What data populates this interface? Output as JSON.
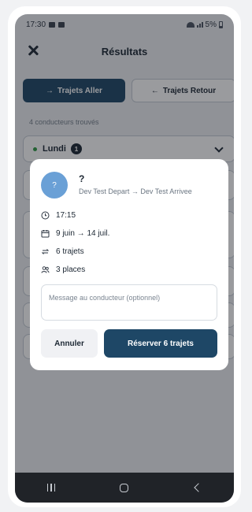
{
  "status_bar": {
    "time": "17:30",
    "battery": "5%"
  },
  "header": {
    "title": "Résultats"
  },
  "tabs": [
    {
      "label": "Trajets Aller",
      "arrow": "→",
      "active": true
    },
    {
      "label": "Trajets Retour",
      "arrow": "←",
      "active": false
    }
  ],
  "results": {
    "count_text": "4 conducteurs trouvés"
  },
  "day": {
    "label": "Lundi",
    "count": "1"
  },
  "modal": {
    "avatar_text": "?",
    "driver_name": "?",
    "route": "Dev Test Depart → Dev Test Arrivee",
    "time": "17:15",
    "dates": "9 juin → 14 juil.",
    "trips": "6 trajets",
    "seats": "3 places",
    "message_placeholder": "Message au conducteur (optionnel)",
    "cancel_label": "Annuler",
    "book_label": "Réserver 6 trajets"
  },
  "colors": {
    "primary": "#1e4766",
    "available_dot": "#2e9a44",
    "avatar": "#6aa0d6"
  },
  "icons": {
    "time": "clock-icon",
    "dates": "calendar-icon",
    "trips": "repeat-icon",
    "seats": "people-icon"
  }
}
